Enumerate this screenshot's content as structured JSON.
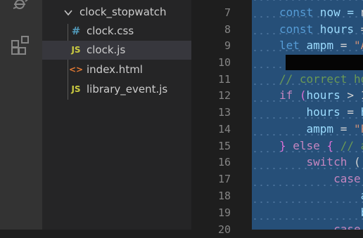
{
  "explorer": {
    "folder": {
      "name": "clock_stopwatch",
      "expanded": true
    },
    "files": [
      {
        "name": "clock.css",
        "icon": "css-file-icon",
        "glyph": "#",
        "selected": false
      },
      {
        "name": "clock.js",
        "icon": "js-file-icon",
        "glyph": "JS",
        "selected": true
      },
      {
        "name": "index.html",
        "icon": "html-file-icon",
        "glyph": "<>",
        "selected": false
      },
      {
        "name": "library_event.js",
        "icon": "js-file-icon",
        "glyph": "JS",
        "selected": false
      }
    ]
  },
  "activity_bar": {
    "icons": [
      "debug-icon",
      "extensions-icon"
    ]
  },
  "editor": {
    "line_numbers": [
      "7",
      "8",
      "9",
      "10",
      "11",
      "12",
      "13",
      "14",
      "15",
      "16",
      "17",
      "18",
      "19",
      "20"
    ],
    "lines": [
      [
        {
          "t": "const",
          "c": "kw"
        },
        {
          "t": " now = ",
          "c": "var"
        },
        {
          "t": "n",
          "c": "op"
        }
      ],
      [
        {
          "t": "const",
          "c": "kw"
        },
        {
          "t": " hours ",
          "c": "var"
        },
        {
          "t": "=",
          "c": "op"
        }
      ],
      [
        {
          "t": "let",
          "c": "kw"
        },
        {
          "t": " ampm ",
          "c": "var"
        },
        {
          "t": "= ",
          "c": "op"
        },
        {
          "t": "\"A",
          "c": "str"
        }
      ],
      [],
      [
        {
          "t": "// correct ho",
          "c": "com"
        }
      ],
      [
        {
          "t": "if",
          "c": "ctrl"
        },
        {
          "t": " (",
          "c": "brk"
        },
        {
          "t": "hours",
          "c": "var"
        },
        {
          "t": " > 1",
          "c": "op"
        }
      ],
      [
        {
          "t": "    hours",
          "c": "var"
        },
        {
          "t": " = ",
          "c": "op"
        },
        {
          "t": "h",
          "c": "var"
        }
      ],
      [
        {
          "t": "    ampm",
          "c": "var"
        },
        {
          "t": " = ",
          "c": "op"
        },
        {
          "t": "\"P",
          "c": "str"
        }
      ],
      [
        {
          "t": "}",
          "c": "brk"
        },
        {
          "t": " else ",
          "c": "ctrl"
        },
        {
          "t": "{",
          "c": "brk"
        },
        {
          "t": " // a",
          "c": "com"
        }
      ],
      [
        {
          "t": "    ",
          "c": "op"
        },
        {
          "t": "switch",
          "c": "ctrl"
        },
        {
          "t": " (",
          "c": "op"
        }
      ],
      [
        {
          "t": "        ",
          "c": "op"
        },
        {
          "t": "case",
          "c": "ctrl"
        }
      ],
      [
        {
          "t": "            a",
          "c": "var"
        }
      ],
      [
        {
          "t": "            b",
          "c": "var"
        }
      ],
      [
        {
          "t": "        ",
          "c": "op"
        },
        {
          "t": "case",
          "c": "ctrl"
        }
      ]
    ]
  },
  "colors": {
    "activity_bar": "#333333",
    "sidebar": "#252526",
    "selection": "#264f78",
    "editor_bg": "#1e1e1e"
  }
}
